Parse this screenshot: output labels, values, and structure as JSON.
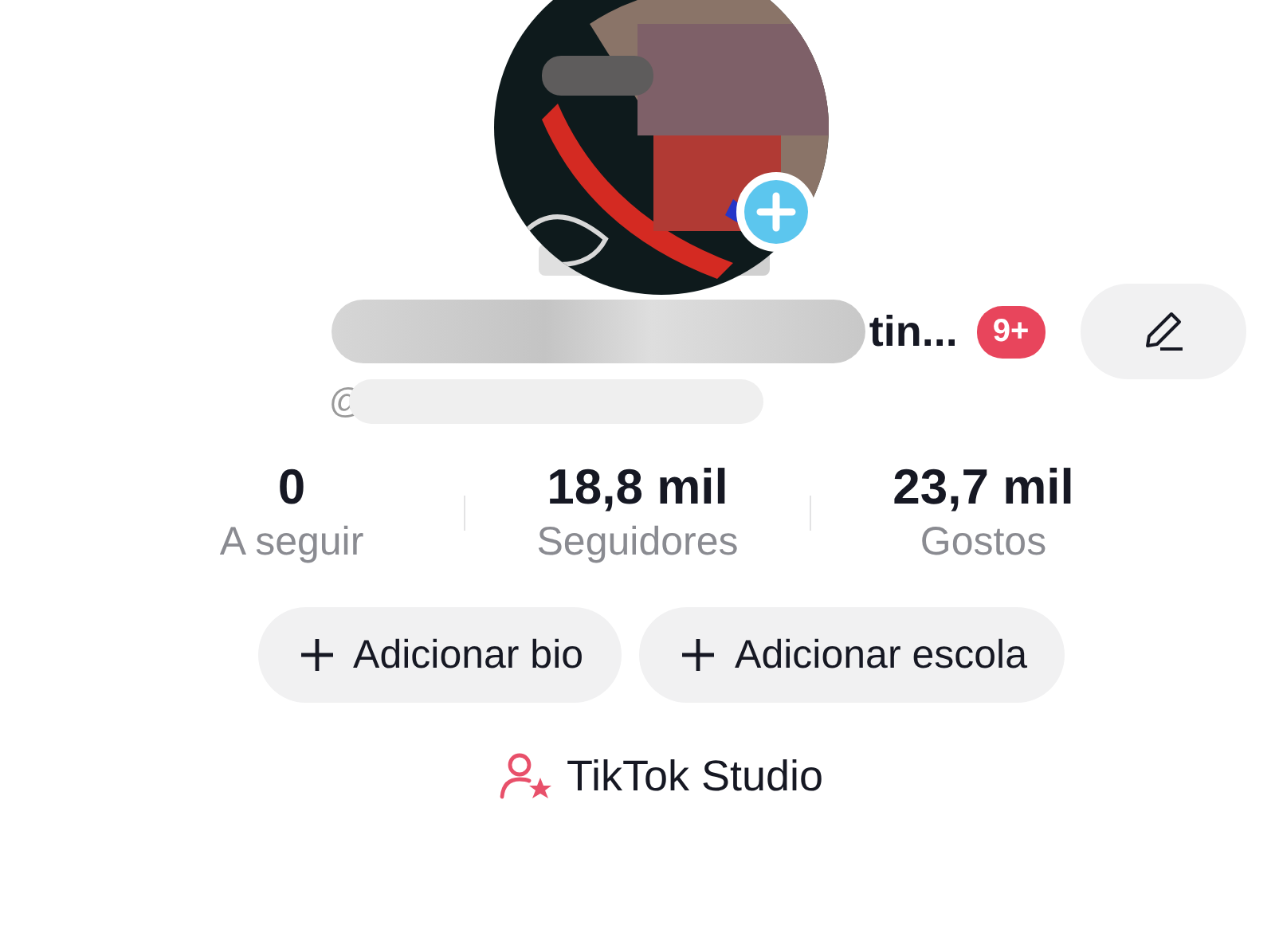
{
  "profile": {
    "name": "tin...",
    "notification_badge": "9+",
    "handle": "@"
  },
  "stats": [
    {
      "value": "0",
      "label": "A seguir"
    },
    {
      "value": "18,8 mil",
      "label": "Seguidores"
    },
    {
      "value": "23,7 mil",
      "label": "Gostos"
    }
  ],
  "actions": [
    {
      "label": "Adicionar bio"
    },
    {
      "label": "Adicionar escola"
    }
  ],
  "studio_link": {
    "label": "TikTok Studio"
  }
}
